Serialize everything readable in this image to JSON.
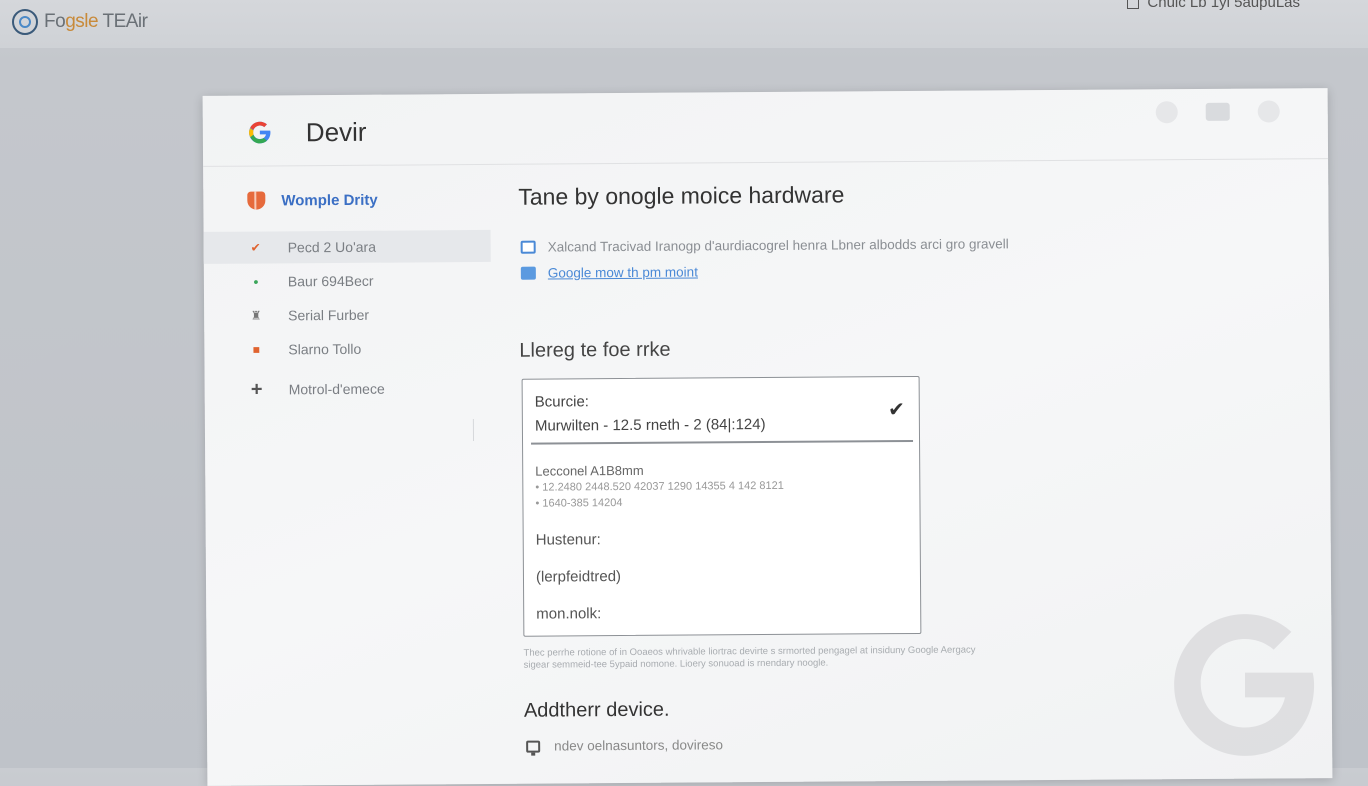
{
  "app": {
    "brand_text_a": "Fo",
    "brand_text_b": "gsle",
    "brand_text_c": " TEAir",
    "top_right_text": "Cnuic Lb 1yi 5aupuLas"
  },
  "window": {
    "title": "Devir"
  },
  "sidebar": {
    "title": "Womple Drity",
    "items": [
      {
        "label": "Pecd 2 Uo'ara",
        "icon": "bolt-icon",
        "active": true
      },
      {
        "label": "Baur 694Becr",
        "icon": "dot-icon",
        "active": false
      },
      {
        "label": "Serial Furber",
        "icon": "bug-icon",
        "active": false
      },
      {
        "label": "Slarno Tollo",
        "icon": "tag-icon",
        "active": false
      },
      {
        "label": "Motrol-d'emece",
        "icon": "plus-icon",
        "active": false
      }
    ]
  },
  "main": {
    "heading": "Tane by onogle moice hardware",
    "info_text": "Xalcand Tracivad Iranogp d'aurdiacogrel henra Lbner albodds arci gro gravell",
    "info_link": "Google mow th pm moint",
    "section_title": "Llereg te foe rrke",
    "card": {
      "label": "Bcurcie:",
      "value": "Murwilten - 12.5 rneth - 2 (84|:124)",
      "sub_title": "Lecconel A1B8mm",
      "sub_line_1": "• 12.2480 2448.520 42037 1290 14355 4 142 8121",
      "sub_line_2": "• 1640-385 14204",
      "row_1": "Hustenur:",
      "row_2": "(lerpfeidtred)",
      "row_3": "mon.nolk:"
    },
    "footnote": "Thec perrhe rotione of in Ooaeos whrivable liortrac devirte s srmorted pengagel at insiduny Google Aergacy sigear semmeid-tee 5ypaid nomone. Lioery sonuoad is rnendary noogle.",
    "add_heading": "Addtherr device.",
    "add_link": "ndev oelnasuntors, dovireso"
  },
  "colors": {
    "accent_blue": "#4a89d6",
    "accent_orange": "#e0632f",
    "sidebar_title": "#3b6fc4"
  }
}
